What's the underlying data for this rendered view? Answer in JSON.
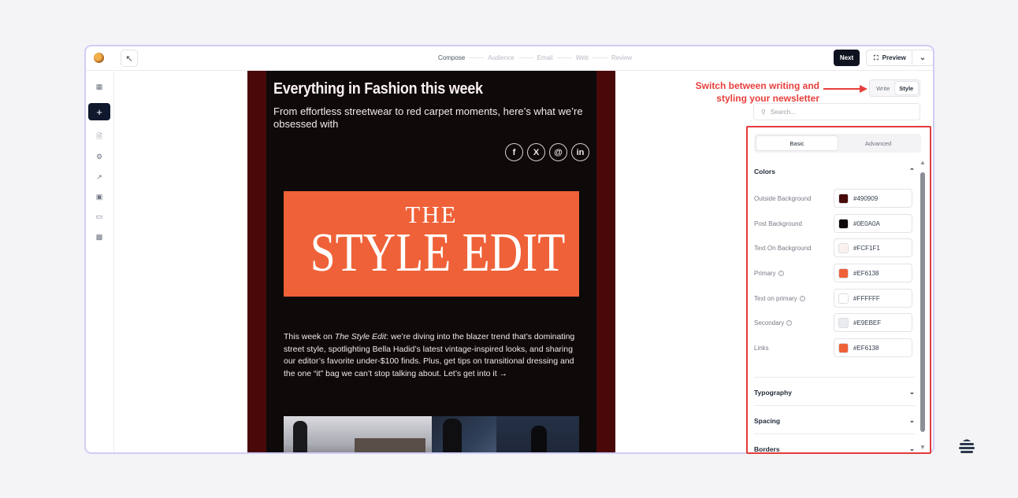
{
  "topbar": {
    "back_icon": "arrow-up-left-icon",
    "steps": [
      {
        "label": "Compose",
        "active": true
      },
      {
        "label": "Audience",
        "active": false
      },
      {
        "label": "Email",
        "active": false
      },
      {
        "label": "Web",
        "active": false
      },
      {
        "label": "Review",
        "active": false
      }
    ],
    "next_label": "Next",
    "preview_label": "Preview"
  },
  "sidebar": {
    "icons": [
      "grid-icon",
      "add-icon",
      "document-icon",
      "bug-icon",
      "trending-icon",
      "monitor-check-icon",
      "desktop-icon",
      "bar-chart-icon"
    ]
  },
  "email": {
    "title": "Everything in Fashion this week",
    "subtitle": "From effortless streetwear to red carpet moments, here’s what we’re obsessed with",
    "social": [
      {
        "icon": "facebook-icon",
        "glyph": "f"
      },
      {
        "icon": "x-icon",
        "glyph": "𝕏"
      },
      {
        "icon": "threads-icon",
        "glyph": "@"
      },
      {
        "icon": "linkedin-icon",
        "glyph": "in"
      }
    ],
    "hero_line1": "THE",
    "hero_line2": "STYLE EDIT",
    "body_prefix": "This week on ",
    "body_italic": "The Style Edit",
    "body_rest": ": we’re diving into the blazer trend that’s dominating street style, spotlighting Bella Hadid’s latest vintage-inspired looks, and sharing our editor’s favorite under-$100 finds. Plus, get tips on transitional dressing and the one “it” bag we can’t stop talking about. Let’s get into it →"
  },
  "annotation": {
    "line1": "Switch between writing and",
    "line2": "styling your newsletter"
  },
  "mode_toggle": {
    "write": "Write",
    "style": "Style",
    "active": "Style"
  },
  "search": {
    "placeholder": "Search..."
  },
  "panel": {
    "tabs": [
      {
        "label": "Basic",
        "active": true
      },
      {
        "label": "Advanced",
        "active": false
      }
    ],
    "colors_heading": "Colors",
    "colors": [
      {
        "label": "Outside Background",
        "value": "#490909",
        "info": false
      },
      {
        "label": "Post Background",
        "value": "#0E0A0A",
        "info": false
      },
      {
        "label": "Text On Background",
        "value": "#FCF1F1",
        "info": false
      },
      {
        "label": "Primary",
        "value": "#EF6138",
        "info": true
      },
      {
        "label": "Text on primary",
        "value": "#FFFFFF",
        "info": true
      },
      {
        "label": "Secondary",
        "value": "#E9EBEF",
        "info": true
      },
      {
        "label": "Links",
        "value": "#EF6138",
        "info": false
      }
    ],
    "sections": [
      "Typography",
      "Spacing",
      "Borders"
    ]
  },
  "theme": {
    "accent": "#0F1320",
    "annotation_red": "#E73F3C",
    "outline": "#CFCDF5"
  }
}
